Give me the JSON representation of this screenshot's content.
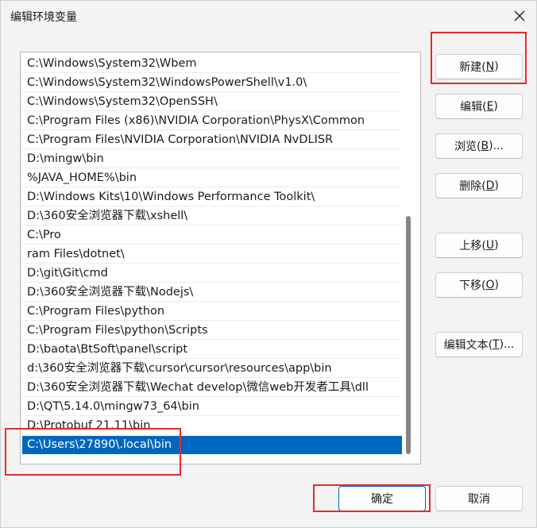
{
  "window": {
    "title": "编辑环境变量"
  },
  "path_list": {
    "items": [
      "C:\\Windows\\System32\\Wbem",
      "C:\\Windows\\System32\\WindowsPowerShell\\v1.0\\",
      "C:\\Windows\\System32\\OpenSSH\\",
      "C:\\Program Files (x86)\\NVIDIA Corporation\\PhysX\\Common",
      "C:\\Program Files\\NVIDIA Corporation\\NVIDIA NvDLISR",
      "D:\\mingw\\bin",
      "%JAVA_HOME%\\bin",
      "D:\\Windows Kits\\10\\Windows Performance Toolkit\\",
      "D:\\360安全浏览器下载\\xshell\\",
      "C:\\Pro",
      "ram Files\\dotnet\\",
      "D:\\git\\Git\\cmd",
      "D:\\360安全浏览器下载\\Nodejs\\",
      "C:\\Program Files\\python",
      "C:\\Program Files\\python\\Scripts",
      "D:\\baota\\BtSoft\\panel\\script",
      "d:\\360安全浏览器下载\\cursor\\cursor\\resources\\app\\bin",
      "D:\\360安全浏览器下载\\Wechat develop\\微信web开发者工具\\dll",
      "D:\\QT\\5.14.0\\mingw73_64\\bin",
      "D:\\Protobuf 21.11\\bin",
      "C:\\Users\\27890\\.local\\bin"
    ],
    "selected_index": 20,
    "scroll_fraction": 0.58
  },
  "buttons": {
    "new": {
      "label": "新建(",
      "key": "N",
      "suffix": ")"
    },
    "edit": {
      "label": "编辑(",
      "key": "E",
      "suffix": ")"
    },
    "browse": {
      "label": "浏览(",
      "key": "B",
      "suffix": ")..."
    },
    "delete": {
      "label": "删除(",
      "key": "D",
      "suffix": ")"
    },
    "move_up": {
      "label": "上移(",
      "key": "U",
      "suffix": ")"
    },
    "move_down": {
      "label": "下移(",
      "key": "O",
      "suffix": ")"
    },
    "edit_text": {
      "label": "编辑文本(",
      "key": "T",
      "suffix": ")..."
    },
    "ok": "确定",
    "cancel": "取消"
  },
  "icons": {
    "close": "close-icon"
  },
  "colors": {
    "selection": "#0067c0",
    "annotation": "#e52b2b",
    "primary_border": "#0067c0"
  }
}
